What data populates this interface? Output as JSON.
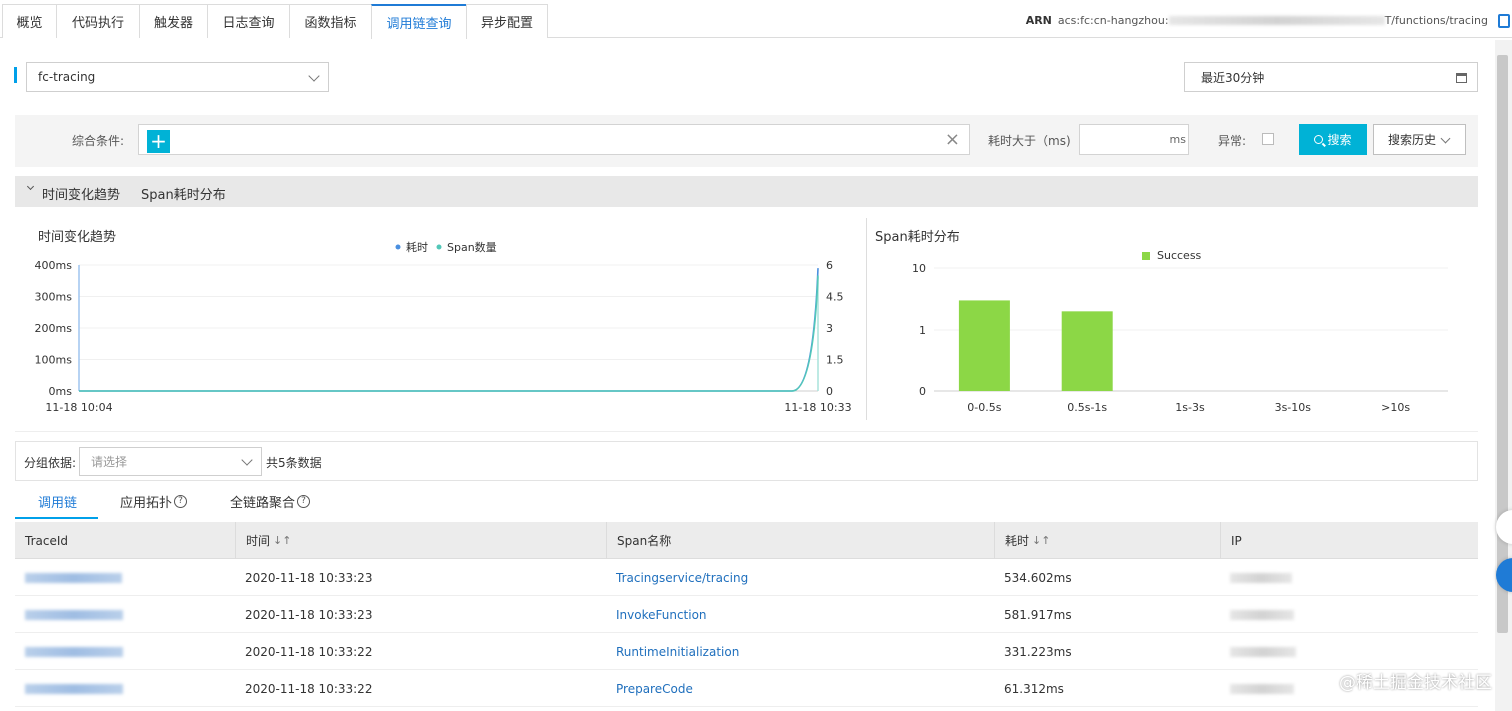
{
  "tabs": [
    {
      "label": "概览",
      "active": false
    },
    {
      "label": "代码执行",
      "active": false
    },
    {
      "label": "触发器",
      "active": false
    },
    {
      "label": "日志查询",
      "active": false
    },
    {
      "label": "函数指标",
      "active": false
    },
    {
      "label": "调用链查询",
      "active": true
    },
    {
      "label": "异步配置",
      "active": false
    }
  ],
  "arn": {
    "label": "ARN",
    "prefix": "acs:fc:cn-hangzhou:",
    "suffix": "T/functions/tracing"
  },
  "service_select": {
    "value": "fc-tracing"
  },
  "time_range": {
    "value": "最近30分钟"
  },
  "search": {
    "condition_label": "综合条件:",
    "plus": "+",
    "clear": "×",
    "duration_label": "耗时大于（ms)",
    "duration_unit": "ms",
    "error_label": "异常:",
    "search_button": "搜索",
    "history_button": "搜索历史"
  },
  "chart_section": {
    "tab1": "时间变化趋势",
    "tab2": "Span耗时分布"
  },
  "chart_data": [
    {
      "type": "line",
      "title": "时间变化趋势",
      "x": [
        "11-18 10:04",
        "11-18 10:33"
      ],
      "series": [
        {
          "name": "耗时",
          "color": "#4a8fe0",
          "y_axis": "left",
          "values": [
            0,
            390
          ]
        },
        {
          "name": "Span数量",
          "color": "#52c7b8",
          "y_axis": "right",
          "values": [
            0,
            5.5
          ]
        }
      ],
      "y_ticks_left": [
        "400ms",
        "300ms",
        "200ms",
        "100ms",
        "0ms"
      ],
      "y_ticks_right": [
        "6",
        "4.5",
        "3",
        "1.5",
        "0"
      ],
      "ylim_left": [
        0,
        400
      ],
      "ylim_right": [
        0,
        6
      ],
      "legend_position": "top-center"
    },
    {
      "type": "bar",
      "title": "Span耗时分布",
      "categories": [
        "0-0.5s",
        "0.5s-1s",
        "1s-3s",
        "3s-10s",
        ">10s"
      ],
      "series": [
        {
          "name": "Success",
          "color": "#8cd746",
          "values": [
            3,
            2,
            0,
            0,
            0
          ]
        }
      ],
      "y_scale": "log",
      "y_ticks": [
        "10",
        "1",
        "0"
      ],
      "legend_position": "top-center"
    }
  ],
  "group": {
    "label": "分组依据:",
    "placeholder": "请选择",
    "count_text": "共5条数据"
  },
  "subtabs": [
    {
      "label": "调用链",
      "active": true,
      "help": false
    },
    {
      "label": "应用拓扑",
      "active": false,
      "help": true
    },
    {
      "label": "全链路聚合",
      "active": false,
      "help": true
    }
  ],
  "table": {
    "columns": [
      "TraceId",
      "时间",
      "Span名称",
      "耗时",
      "IP"
    ],
    "sort_icon": "↓↑",
    "rows": [
      {
        "time": "2020-11-18 10:33:23",
        "span": "Tracingservice/tracing",
        "duration": "534.602ms"
      },
      {
        "time": "2020-11-18 10:33:23",
        "span": "InvokeFunction",
        "duration": "581.917ms"
      },
      {
        "time": "2020-11-18 10:33:22",
        "span": "RuntimeInitialization",
        "duration": "331.223ms"
      },
      {
        "time": "2020-11-18 10:33:22",
        "span": "PrepareCode",
        "duration": "61.312ms"
      }
    ]
  },
  "watermark": "@稀土掘金技术社区"
}
